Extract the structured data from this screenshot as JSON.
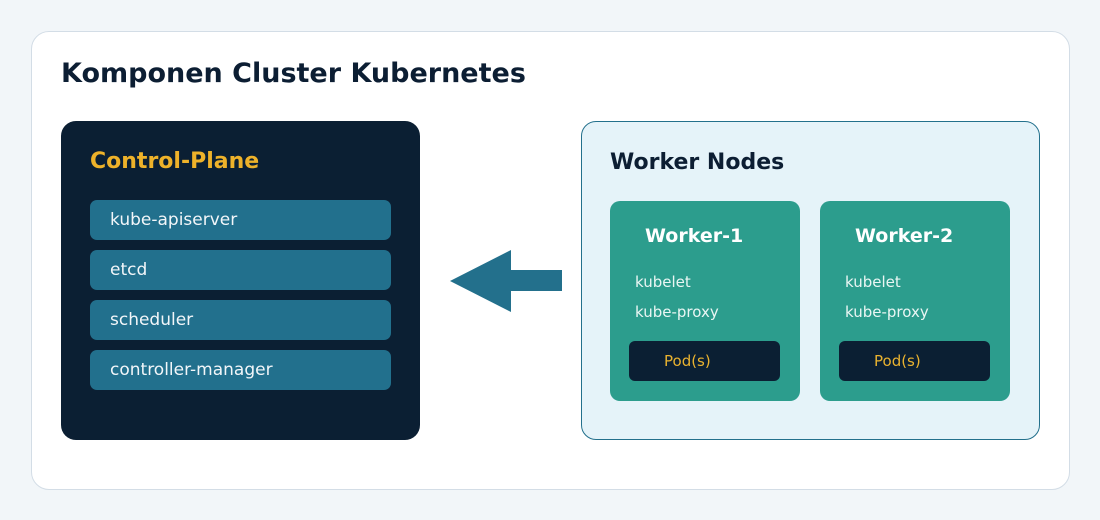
{
  "title": "Komponen Cluster Kubernetes",
  "control_plane": {
    "title": "Control-Plane",
    "components": [
      "kube-apiserver",
      "etcd",
      "scheduler",
      "controller-manager"
    ]
  },
  "worker_nodes": {
    "title": "Worker Nodes",
    "workers": [
      {
        "name": "Worker-1",
        "components": [
          "kubelet",
          "kube-proxy"
        ],
        "pods_label": "Pod(s)"
      },
      {
        "name": "Worker-2",
        "components": [
          "kubelet",
          "kube-proxy"
        ],
        "pods_label": "Pod(s)"
      }
    ]
  },
  "connector": {
    "direction": "left",
    "icon": "arrow-left-icon"
  },
  "colors": {
    "background": "#f2f6f9",
    "card": "#ffffff",
    "control_plane_bg": "#0b1f33",
    "control_plane_title": "#eeb22a",
    "component_bg": "#22708d",
    "worker_nodes_bg": "#e5f3f9",
    "worker_bg": "#2c9d8d",
    "pod_bg": "#0b1f33",
    "pod_text": "#e9b22f",
    "arrow": "#23708c"
  }
}
